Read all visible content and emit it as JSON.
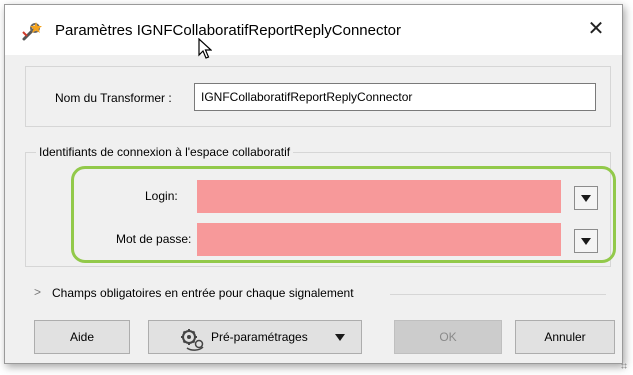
{
  "window": {
    "title": "Paramètres IGNFCollaboratifReportReplyConnector",
    "close_label": "✕",
    "icon": "wrench-star-icon"
  },
  "transformer": {
    "label": "Nom du Transformer :",
    "value": "IGNFCollaboratifReportReplyConnector"
  },
  "credentials": {
    "group_label": "Identifiants de connexion à l'espace collaboratif",
    "login_label": "Login:",
    "login_value": "",
    "password_label": "Mot de passe:",
    "password_value": "",
    "highlight_color": "#92c94a",
    "empty_field_color": "#f7999a"
  },
  "expander": {
    "icon": "chevron-right-icon",
    "label": "Champs obligatoires en entrée pour chaque signalement"
  },
  "buttons": {
    "help": "Aide",
    "presets": "Pré-paramétrages",
    "ok": "OK",
    "cancel": "Annuler"
  }
}
